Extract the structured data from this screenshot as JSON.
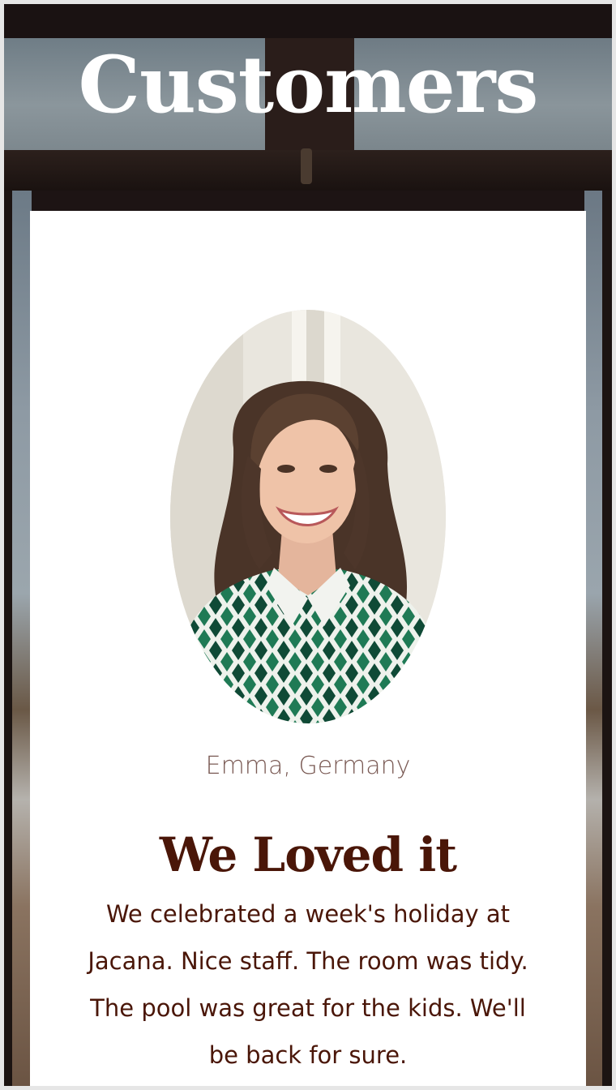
{
  "page": {
    "title": "Customers"
  },
  "testimonial": {
    "avatar_icon": "customer-photo",
    "reviewer": "Emma, Germany",
    "headline": "We Loved it",
    "text": "We celebrated a week's holiday at Jacana. Nice staff. The room was tidy. The pool was great for the kids. We'll be back for sure."
  },
  "colors": {
    "title_text": "#ffffff",
    "card_background": "#ffffff",
    "headline_text": "#4a1608",
    "reviewer_text": "#7a5a54"
  }
}
